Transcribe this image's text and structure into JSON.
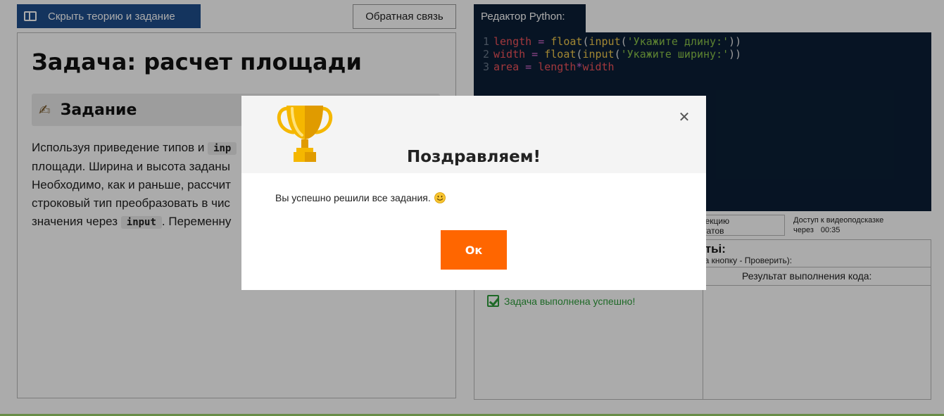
{
  "toolbar": {
    "hide_button_label": "Скрыть теорию и задание",
    "feedback_button_label": "Обратная связь"
  },
  "task": {
    "title": "Задача: расчет площади",
    "section_label": "Задание",
    "text_part1": "Используя приведение типов и ",
    "code_input_1": "inp",
    "text_part2": "площади. Ширина и высота заданы",
    "text_part3": "Необходимо, как и раньше, рассчит",
    "text_part4": "строковый тип преобразовать в чис",
    "text_part5": "значения через ",
    "code_input_2": "input",
    "text_part6": ". Переменну"
  },
  "editor": {
    "tab_label": "Редактор Python:",
    "lines": [
      {
        "num": "1",
        "var": "length",
        "op": " = ",
        "fn1": "float",
        "p1": "(",
        "fn2": "input",
        "p2": "(",
        "str": "'Укажите длину:'",
        "p3": "))"
      },
      {
        "num": "2",
        "var": "width",
        "op": " = ",
        "fn1": "float",
        "p1": "(",
        "fn2": "input",
        "p2": "(",
        "str": "'Укажите ширину:'",
        "p3": "))"
      },
      {
        "num": "3",
        "var": "area",
        "op": " = ",
        "var2": "length",
        "mul": "*",
        "var3": "width"
      }
    ]
  },
  "results": {
    "toggle_line1": "ь секцию",
    "toggle_line2": "льтатов",
    "video_hint_line1": "Доступ к видеоподсказке",
    "video_hint_line2": "через",
    "video_timer": "00:35",
    "title": "татьі:",
    "subtitle": "и на кнопку - Проверить):",
    "col_header": "Результат выполнения кода:",
    "status": "Задача выполнена успешно!"
  },
  "modal": {
    "title": "Поздравляем!",
    "message": "Вы успешно решили все задания.",
    "ok_label": "Ок",
    "close_symbol": "✕",
    "trophy_color": "#f5b700",
    "ok_color": "#ff6600"
  }
}
